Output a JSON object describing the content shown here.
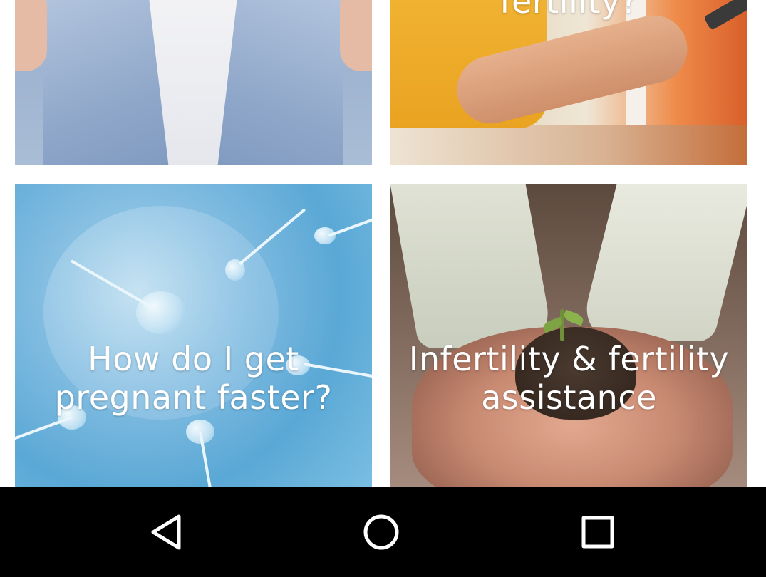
{
  "tiles": [
    {
      "label": ""
    },
    {
      "label": "fertility?"
    },
    {
      "label_line1": "How do I get",
      "label_line2": "pregnant faster?"
    },
    {
      "label_line1": "Infertility & fertility",
      "label_line2": "assistance"
    }
  ],
  "navbar": {
    "back_icon": "back-triangle-icon",
    "home_icon": "home-circle-icon",
    "recents_icon": "recents-square-icon",
    "background_color": "#000000",
    "icon_color": "#ffffff"
  }
}
